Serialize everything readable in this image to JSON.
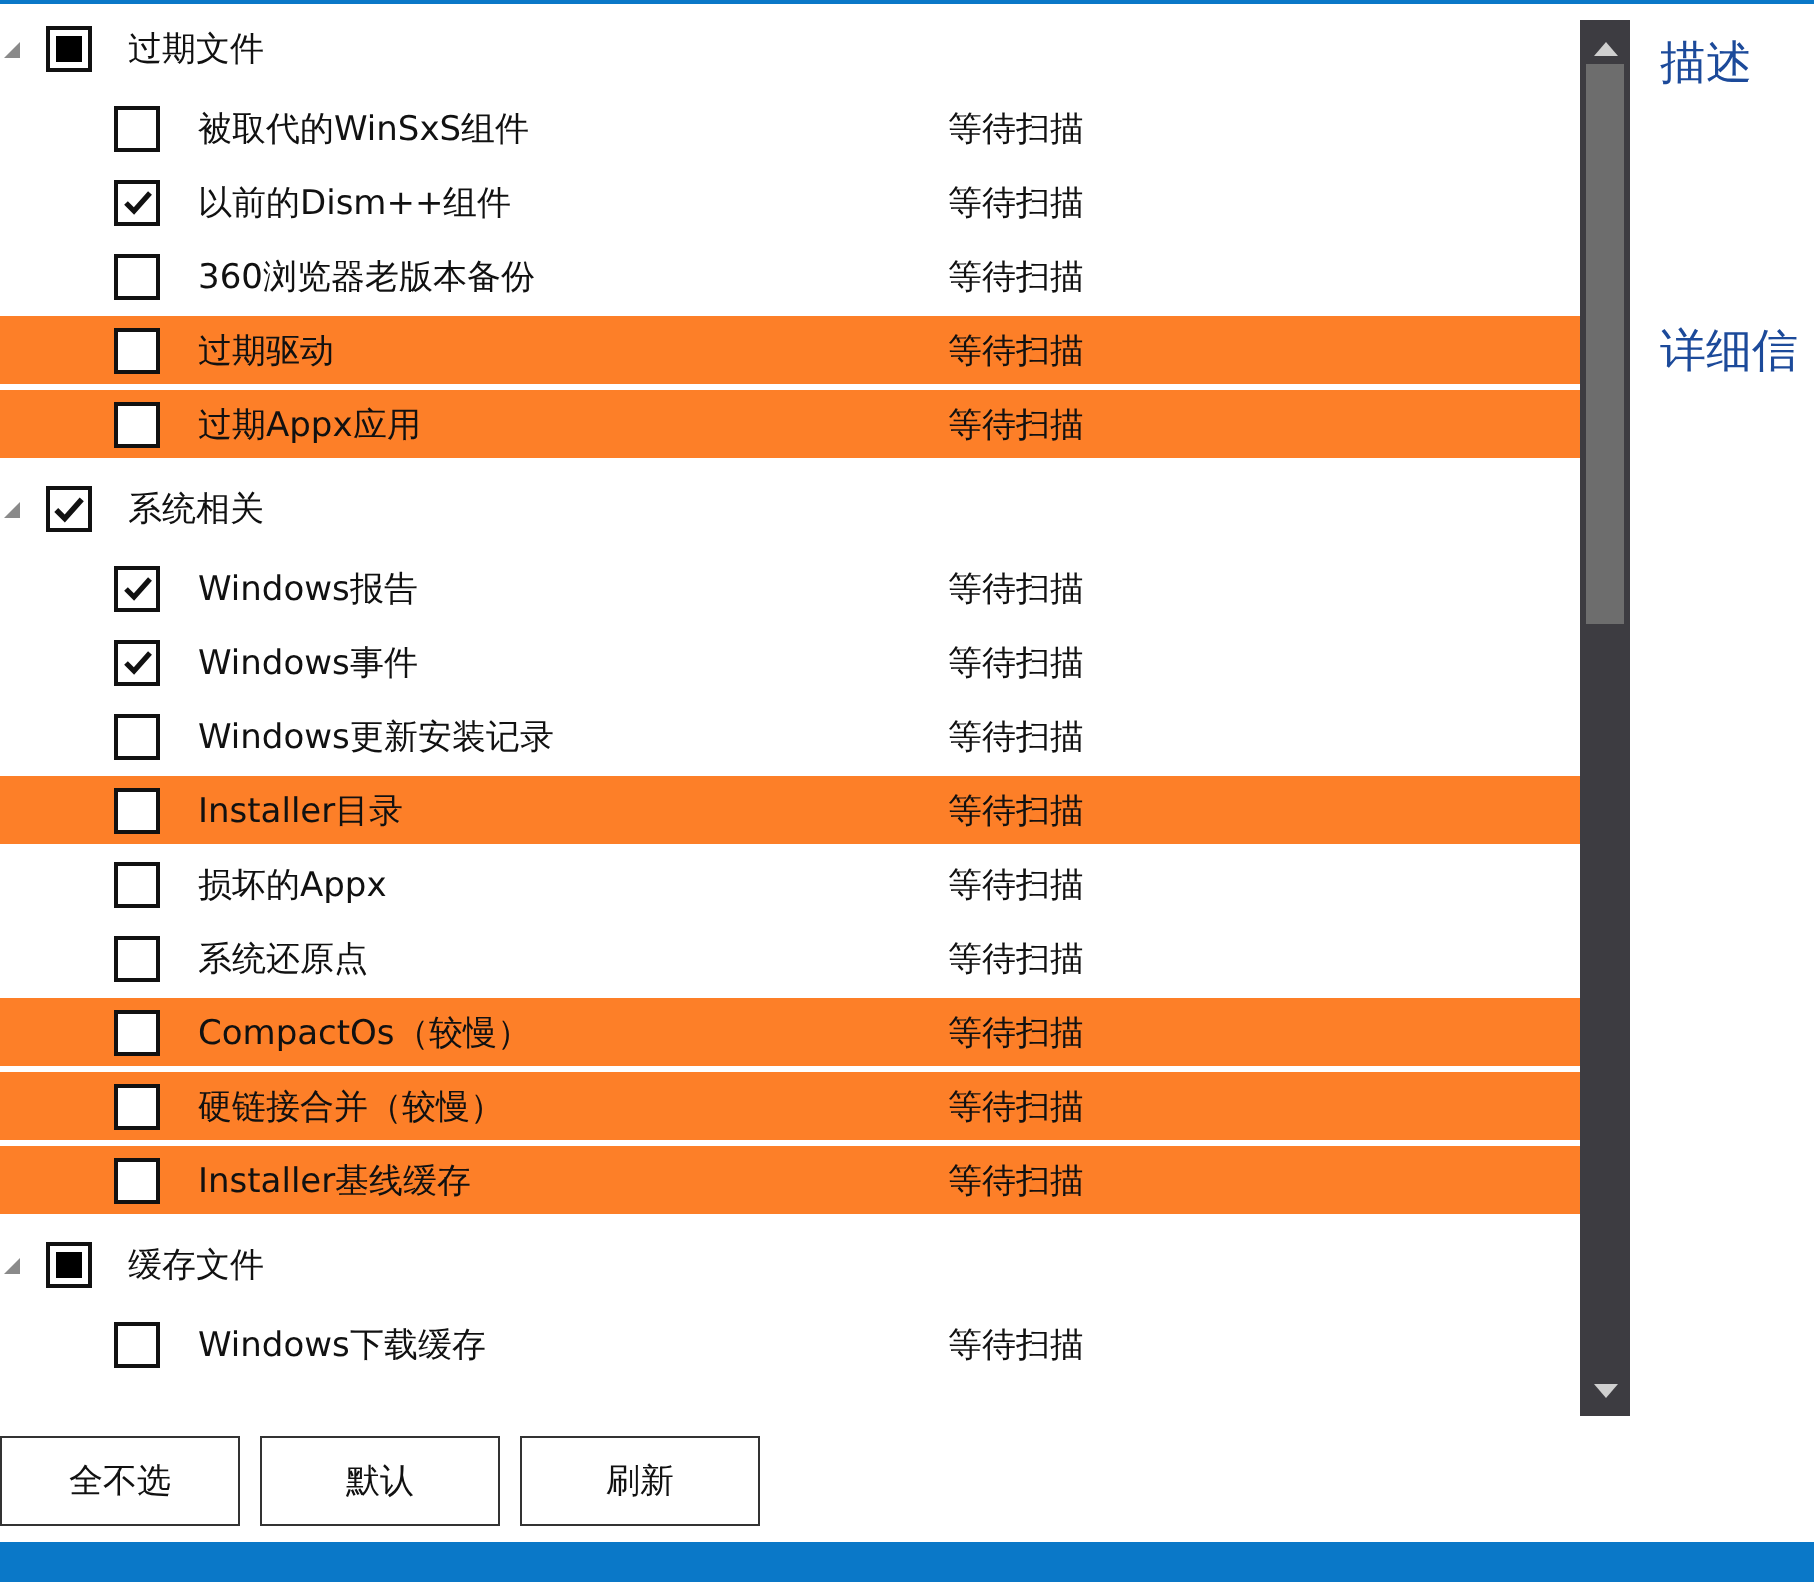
{
  "groups": [
    {
      "label": "过期文件",
      "checked": false,
      "partial": true,
      "expanded": true,
      "items": [
        {
          "label": "被取代的WinSxS组件",
          "status": "等待扫描",
          "checked": false,
          "highlighted": false
        },
        {
          "label": "以前的Dism++组件",
          "status": "等待扫描",
          "checked": true,
          "highlighted": false
        },
        {
          "label": "360浏览器老版本备份",
          "status": "等待扫描",
          "checked": false,
          "highlighted": false
        },
        {
          "label": "过期驱动",
          "status": "等待扫描",
          "checked": false,
          "highlighted": true
        },
        {
          "label": "过期Appx应用",
          "status": "等待扫描",
          "checked": false,
          "highlighted": true
        }
      ]
    },
    {
      "label": "系统相关",
      "checked": true,
      "partial": false,
      "expanded": true,
      "items": [
        {
          "label": "Windows报告",
          "status": "等待扫描",
          "checked": true,
          "highlighted": false
        },
        {
          "label": "Windows事件",
          "status": "等待扫描",
          "checked": true,
          "highlighted": false
        },
        {
          "label": "Windows更新安装记录",
          "status": "等待扫描",
          "checked": false,
          "highlighted": false
        },
        {
          "label": "Installer目录",
          "status": "等待扫描",
          "checked": false,
          "highlighted": true
        },
        {
          "label": "损坏的Appx",
          "status": "等待扫描",
          "checked": false,
          "highlighted": false
        },
        {
          "label": "系统还原点",
          "status": "等待扫描",
          "checked": false,
          "highlighted": false
        },
        {
          "label": "CompactOs（较慢）",
          "status": "等待扫描",
          "checked": false,
          "highlighted": true
        },
        {
          "label": "硬链接合并（较慢）",
          "status": "等待扫描",
          "checked": false,
          "highlighted": true
        },
        {
          "label": "Installer基线缓存",
          "status": "等待扫描",
          "checked": false,
          "highlighted": true
        }
      ]
    },
    {
      "label": "缓存文件",
      "checked": false,
      "partial": true,
      "expanded": true,
      "items": [
        {
          "label": "Windows下载缓存",
          "status": "等待扫描",
          "checked": false,
          "highlighted": false
        }
      ]
    }
  ],
  "side_panel": {
    "description_heading": "描述",
    "details_heading": "详细信"
  },
  "buttons": [
    "全不选",
    "默认",
    "刷新"
  ]
}
